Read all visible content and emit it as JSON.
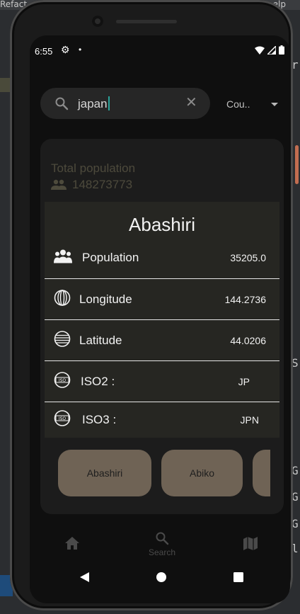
{
  "ide": {
    "top_left": "Refact",
    "top_right": "elp",
    "right_glyphs": [
      "r",
      "S",
      "G",
      "G",
      "G",
      "l"
    ]
  },
  "status_bar": {
    "time": "6:55"
  },
  "search": {
    "value": "japan",
    "type_label": "Cou.."
  },
  "summary": {
    "label": "Total population",
    "value": "148273773"
  },
  "city_detail": {
    "name": "Abashiri",
    "rows": [
      {
        "label": "Population",
        "value": "35205.0",
        "icon": "people-icon"
      },
      {
        "label": "Longitude",
        "value": "144.2736",
        "icon": "globe-meridian-icon"
      },
      {
        "label": "Latitude",
        "value": "44.0206",
        "icon": "globe-latitude-icon"
      },
      {
        "label": "ISO2 :",
        "value": "JP",
        "icon": "iso-globe-icon"
      },
      {
        "label": "ISO3 :",
        "value": "JPN",
        "icon": "iso-globe-icon"
      }
    ]
  },
  "cities": [
    "Abashiri",
    "Abiko"
  ],
  "bottom_nav": {
    "home_icon": "home-icon",
    "search_label": "Search",
    "map_icon": "map-icon"
  },
  "colors": {
    "screen_bg": "#0f0f0f",
    "card_bg": "#1c1c1c",
    "detail_bg": "#262622",
    "chip_bg": "#6f6355",
    "caret": "#2aa49b",
    "muted_text": "#4d4a3c"
  }
}
